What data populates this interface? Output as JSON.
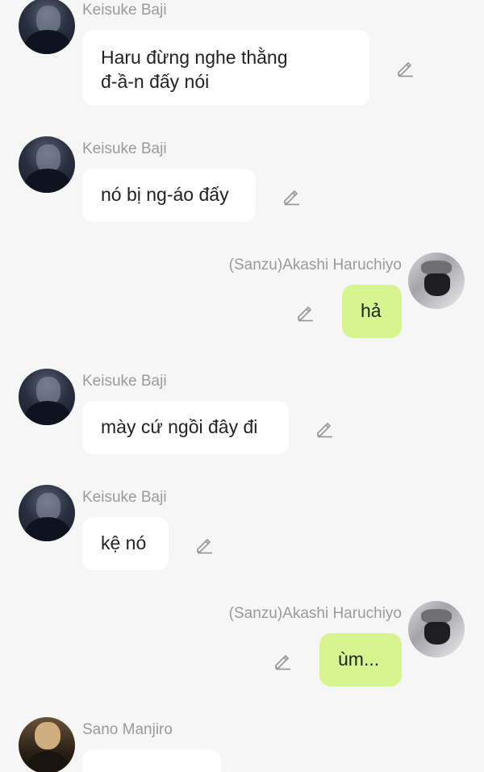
{
  "colors": {
    "background": "#f6f6f6",
    "incoming_bubble": "#ffffff",
    "outgoing_bubble": "#d6f58e",
    "sender_name": "#9a9a9a",
    "message_text": "#222222"
  },
  "messages": [
    {
      "sender": "Keisuke Baji",
      "side": "left",
      "avatar": "baji-avatar",
      "text_lines": [
        "Haru đừng nghe thằng",
        "đ-ầ-n đấy nói"
      ]
    },
    {
      "sender": "Keisuke Baji",
      "side": "left",
      "avatar": "baji-avatar",
      "text_lines": [
        "nó bị ng-áo đấy"
      ]
    },
    {
      "sender": "(Sanzu)Akashi Haruchiyo",
      "side": "right",
      "avatar": "sanzu-avatar",
      "text_lines": [
        "hả"
      ]
    },
    {
      "sender": "Keisuke Baji",
      "side": "left",
      "avatar": "baji-avatar",
      "text_lines": [
        "mày cứ ngồi đây đi"
      ]
    },
    {
      "sender": "Keisuke Baji",
      "side": "left",
      "avatar": "baji-avatar",
      "text_lines": [
        "kệ nó"
      ]
    },
    {
      "sender": "(Sanzu)Akashi Haruchiyo",
      "side": "right",
      "avatar": "sanzu-avatar",
      "text_lines": [
        "ùm..."
      ]
    },
    {
      "sender": "Sano Manjiro",
      "side": "left",
      "avatar": "mikey-avatar",
      "text_lines": []
    }
  ]
}
